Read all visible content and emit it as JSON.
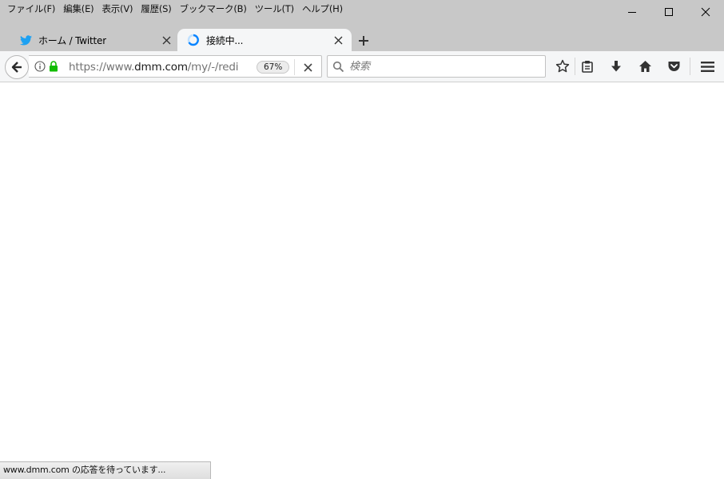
{
  "menubar": {
    "items": [
      {
        "label": "ファイル(F)"
      },
      {
        "label": "編集(E)"
      },
      {
        "label": "表示(V)"
      },
      {
        "label": "履歴(S)"
      },
      {
        "label": "ブックマーク(B)"
      },
      {
        "label": "ツール(T)"
      },
      {
        "label": "ヘルプ(H)"
      }
    ]
  },
  "tabs": [
    {
      "label": "ホーム / Twitter",
      "icon": "twitter-bird-icon",
      "active": false
    },
    {
      "label": "接続中...",
      "icon": "loading-spinner-icon",
      "active": true
    }
  ],
  "navbar": {
    "url_prefix": "https://www.",
    "url_host": "dmm.com",
    "url_path": "/my/-/redire",
    "zoom": "67%",
    "search_placeholder": "検索"
  },
  "status": {
    "text": "www.dmm.com の応答を待っています..."
  },
  "colors": {
    "titlebar_bg": "#c8c8c8",
    "toolbar_bg": "#f5f6f7",
    "twitter_blue": "#1da1f2",
    "lock_green": "#12bc00",
    "spinner_blue": "#0a84ff"
  }
}
